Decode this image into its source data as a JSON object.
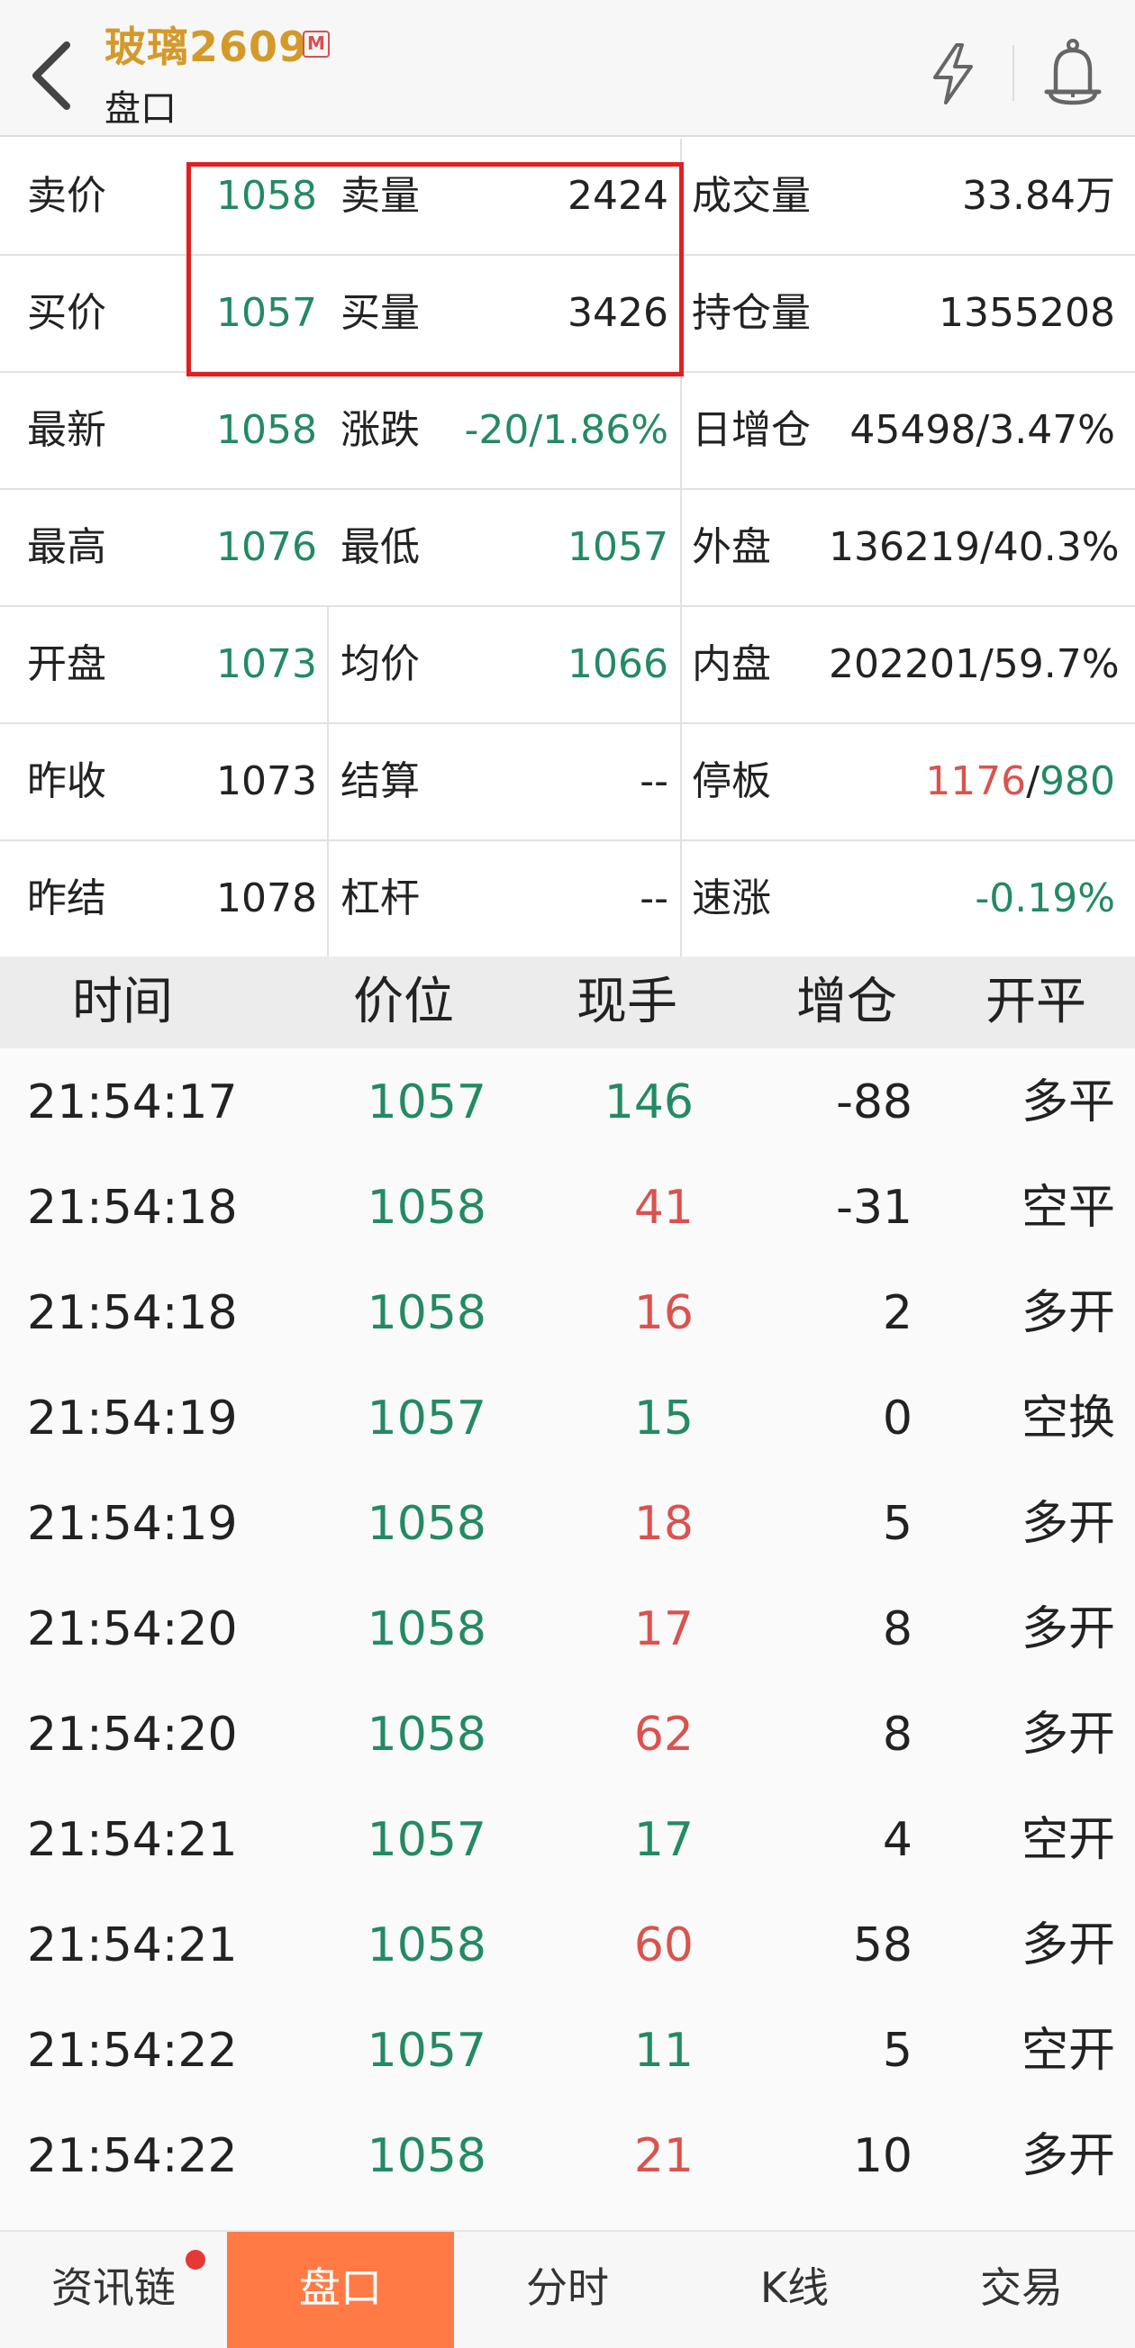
{
  "header": {
    "title": "玻璃2609",
    "badge": "M",
    "subtitle": "盘口",
    "back_icon": "chevron-left-icon",
    "flash_icon": "lightning-icon",
    "alert_icon": "bell-icon"
  },
  "quote": {
    "ask_label": "卖价",
    "ask_price": "1058",
    "ask_vol_label": "卖量",
    "ask_vol": "2424",
    "volume_label": "成交量",
    "volume": "33.84万",
    "bid_label": "买价",
    "bid_price": "1057",
    "bid_vol_label": "买量",
    "bid_vol": "3426",
    "oi_label": "持仓量",
    "oi": "1355208",
    "last_label": "最新",
    "last": "1058",
    "change_label": "涨跌",
    "change": "-20/1.86%",
    "oi_change_label": "日增仓",
    "oi_change": "45498/3.47%",
    "high_label": "最高",
    "high": "1076",
    "low_label": "最低",
    "low": "1057",
    "outer_label": "外盘",
    "outer": "136219/40.3%",
    "open_label": "开盘",
    "open": "1073",
    "avg_label": "均价",
    "avg": "1066",
    "inner_label": "内盘",
    "inner": "202201/59.7%",
    "prev_close_label": "昨收",
    "prev_close": "1073",
    "settle_label": "结算",
    "settle": "--",
    "limit_label": "停板",
    "limit_up": "1176",
    "limit_sep": "/",
    "limit_down": "980",
    "prev_settle_label": "昨结",
    "prev_settle": "1078",
    "leverage_label": "杠杆",
    "leverage": "--",
    "speed_label": "速涨",
    "speed": "-0.19%"
  },
  "trades": {
    "headers": [
      "时间",
      "价位",
      "现手",
      "增仓",
      "开平"
    ],
    "rows": [
      {
        "time": "21:54:17",
        "price": "1057",
        "qty": "146",
        "qty_color": "green",
        "oi": "-88",
        "type": "多平"
      },
      {
        "time": "21:54:18",
        "price": "1058",
        "qty": "41",
        "qty_color": "red",
        "oi": "-31",
        "type": "空平"
      },
      {
        "time": "21:54:18",
        "price": "1058",
        "qty": "16",
        "qty_color": "red",
        "oi": "2",
        "type": "多开"
      },
      {
        "time": "21:54:19",
        "price": "1057",
        "qty": "15",
        "qty_color": "green",
        "oi": "0",
        "type": "空换"
      },
      {
        "time": "21:54:19",
        "price": "1058",
        "qty": "18",
        "qty_color": "red",
        "oi": "5",
        "type": "多开"
      },
      {
        "time": "21:54:20",
        "price": "1058",
        "qty": "17",
        "qty_color": "red",
        "oi": "8",
        "type": "多开"
      },
      {
        "time": "21:54:20",
        "price": "1058",
        "qty": "62",
        "qty_color": "red",
        "oi": "8",
        "type": "多开"
      },
      {
        "time": "21:54:21",
        "price": "1057",
        "qty": "17",
        "qty_color": "green",
        "oi": "4",
        "type": "空开"
      },
      {
        "time": "21:54:21",
        "price": "1058",
        "qty": "60",
        "qty_color": "red",
        "oi": "58",
        "type": "多开"
      },
      {
        "time": "21:54:22",
        "price": "1057",
        "qty": "11",
        "qty_color": "green",
        "oi": "5",
        "type": "空开"
      },
      {
        "time": "21:54:22",
        "price": "1058",
        "qty": "21",
        "qty_color": "red",
        "oi": "10",
        "type": "多开"
      }
    ]
  },
  "nav": {
    "tabs": [
      "资讯链",
      "盘口",
      "分时",
      "K线",
      "交易"
    ],
    "active_tab": "盘口"
  },
  "colors": {
    "up": "#d9534f",
    "down": "#238a63",
    "accent": "#ff7a45",
    "title": "#d39a2b",
    "highlight_box": "#e02020"
  }
}
